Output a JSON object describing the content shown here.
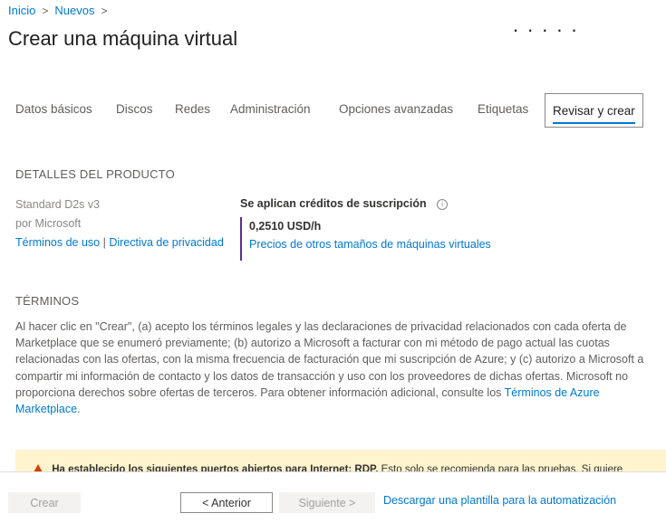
{
  "breadcrumb": {
    "items": [
      "Inicio",
      "Nuevos"
    ],
    "separator": ">"
  },
  "page": {
    "title": "Crear una máquina virtual",
    "more_icon": "ellipsis-icon",
    "more_label": "....."
  },
  "tabs": [
    {
      "label": "Datos básicos",
      "active": false
    },
    {
      "label": "Discos",
      "active": false
    },
    {
      "label": "Redes",
      "active": false
    },
    {
      "label": "Administración",
      "active": false
    },
    {
      "label": "Opciones avanzadas",
      "active": false
    },
    {
      "label": "Etiquetas",
      "active": false
    },
    {
      "label": "Revisar y crear",
      "active": true
    }
  ],
  "product": {
    "heading": "DETALLES DEL PRODUCTO",
    "name": "Standard D2s v3",
    "publisher": "por Microsoft",
    "terms_link": "Términos de uso",
    "link_separator": "|",
    "privacy_link": "Directiva de privacidad",
    "credits_label": "Se aplican créditos de suscripción",
    "info_icon": "info-icon",
    "price": "0,2510 USD/h",
    "pricing_link": "Precios de otros tamaños de máquinas virtuales"
  },
  "terms": {
    "heading": "TÉRMINOS",
    "body": "Al hacer clic en \"Crear\", (a) acepto los términos legales y las declaraciones de privacidad relacionados con cada oferta de Marketplace que se enumeró previamente; (b) autorizo a Microsoft a facturar con mi método de pago actual las cuotas relacionadas con las ofertas, con la misma frecuencia de facturación que mi suscripción de Azure; y (c) autorizo a Microsoft a compartir mi información de contacto y los datos de transacción y uso con los proveedores de dichas ofertas. Microsoft no proporciona derechos sobre ofertas de terceros. Para obtener información adicional, consulte los",
    "link": "Términos de Azure Marketplace",
    "end": "."
  },
  "warning": {
    "icon": "warning-icon",
    "bold_text": "Ha establecido los siguientes puertos abiertos para Internet: RDP.",
    "text": "Esto solo se recomienda para las pruebas. Si quiere"
  },
  "footer": {
    "create_label": "Crear",
    "previous_label": "< Anterior",
    "next_label": "Siguiente >",
    "download_link": "Descargar una plantilla para la automatización"
  },
  "colors": {
    "accent": "#0078d4",
    "price_bar": "#5c2d91",
    "warning_bg": "#fff4ce",
    "warning_icon": "#d83b01"
  }
}
